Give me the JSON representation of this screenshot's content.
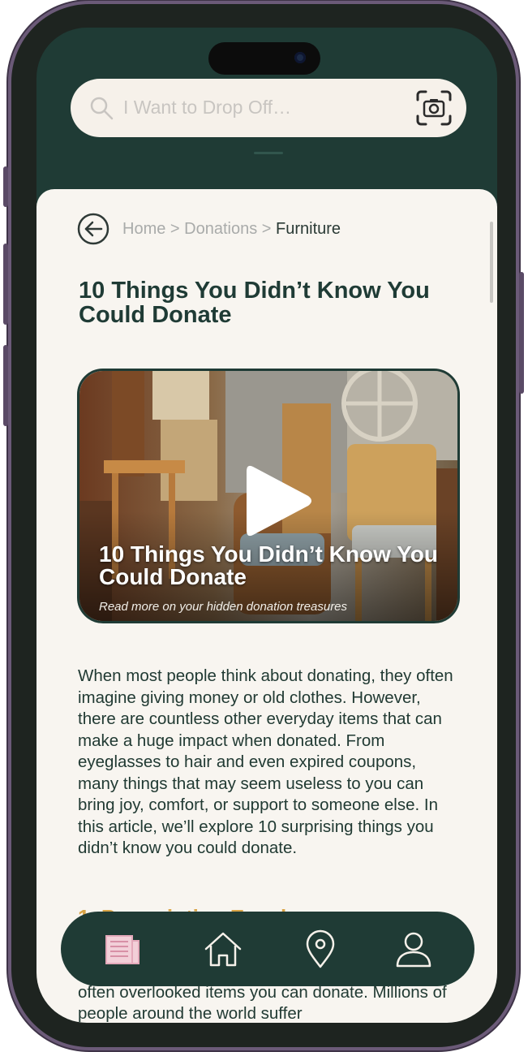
{
  "search": {
    "placeholder": "I Want to Drop Off…"
  },
  "breadcrumb": {
    "home": "Home",
    "separator": " > ",
    "donations": "Donations",
    "current": "Furniture"
  },
  "article": {
    "title": "10 Things You Didn’t Know You Could Donate",
    "video": {
      "title": "10 Things You Didn’t Know You Could Donate",
      "subtitle": "Read more on your hidden donation treasures"
    },
    "intro": "When most people think about donating, they often imagine giving money or old clothes. However, there are countless other everyday items that can make a huge impact when donated. From eyeglasses to hair and even expired coupons, many things that may seem useless to you can bring joy, comfort, or support to someone else. In this article, we’ll explore 10 surprising things you didn’t know you could donate.",
    "section_heading": "1. Prescription Eyeglasses",
    "section_body": "often overlooked items you can donate. Millions of people around the world suffer"
  },
  "nav": {
    "items": [
      {
        "icon": "articles-icon",
        "active": true
      },
      {
        "icon": "home-icon",
        "active": false
      },
      {
        "icon": "location-pin-icon",
        "active": false
      },
      {
        "icon": "profile-icon",
        "active": false
      }
    ]
  },
  "colors": {
    "primary": "#1f3b35",
    "background": "#f8f5f0",
    "accent": "#d9a446",
    "active_icon": "#f2cfd8",
    "icon": "#f6f1ea"
  }
}
